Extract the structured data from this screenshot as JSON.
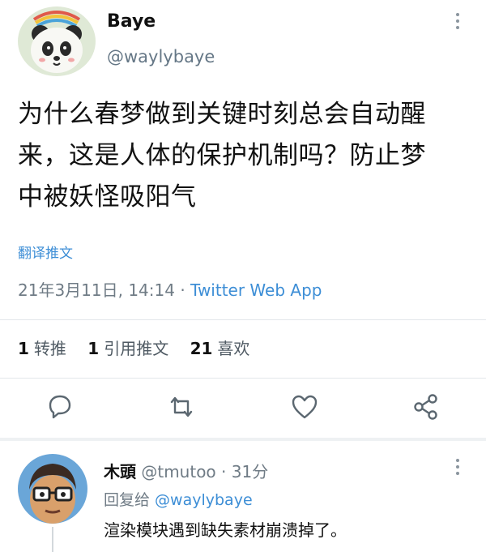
{
  "author": {
    "name": "Baye",
    "handle": "@waylybaye"
  },
  "tweet": {
    "text_lines": [
      "为什么春梦做到关键时刻总会自动醒",
      "来，这是人体的保护机制吗？防止梦",
      "中被妖怪吸阳气"
    ],
    "translate_label": "翻译推文",
    "timestamp": "21年3月11日, 14:14 · ",
    "source_app": "Twitter Web App"
  },
  "stats": {
    "retweets_count": "1",
    "retweets_label": "转推",
    "quotes_count": "1",
    "quotes_label": "引用推文",
    "likes_count": "21",
    "likes_label": "喜欢"
  },
  "actions": {
    "icons": [
      "reply-icon",
      "retweet-icon",
      "like-icon",
      "share-icon"
    ]
  },
  "reply": {
    "name": "木頭",
    "handle_time": " @tmutoo · 31分",
    "replying_to_label": "回复给 ",
    "replying_to_handle": "@waylybaye",
    "text": "渲染模块遇到缺失素材崩溃掉了。"
  },
  "colors": {
    "link": "#3d8ed6",
    "secondary_text": "#6f7b85",
    "icon": "#5b6770"
  }
}
